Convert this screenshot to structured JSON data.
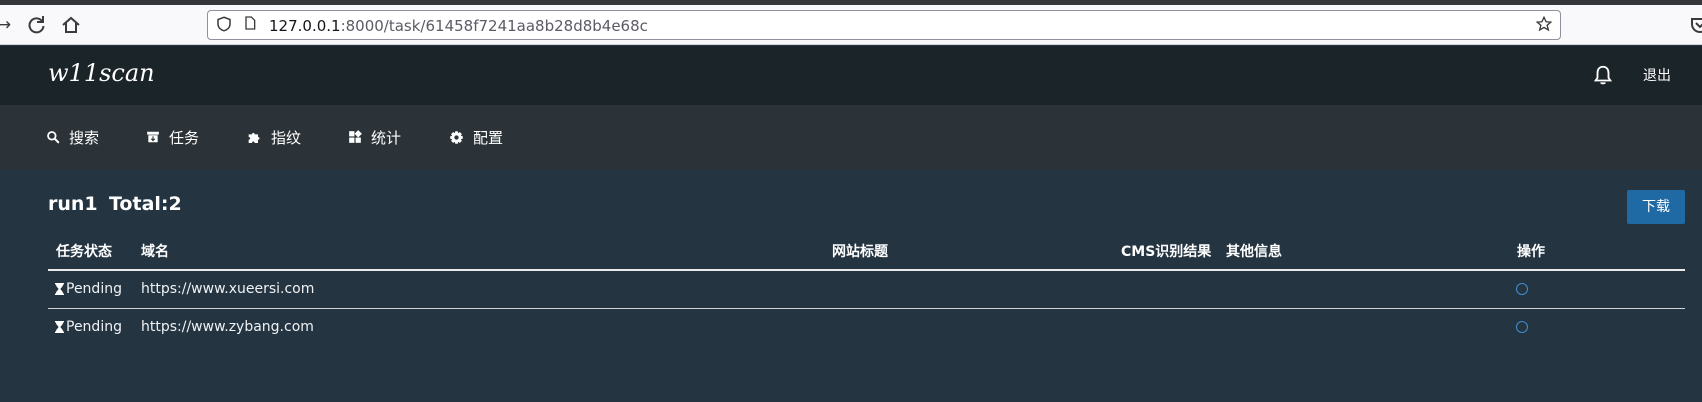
{
  "browser": {
    "url_host": "127.0.0.1",
    "url_rest": ":8000/task/61458f7241aa8b28d8b4e68c"
  },
  "header": {
    "brand": "w11scan",
    "logout_label": "退出"
  },
  "menu": [
    {
      "label": "搜索",
      "icon": "search-icon"
    },
    {
      "label": "任务",
      "icon": "archive-icon"
    },
    {
      "label": "指纹",
      "icon": "puzzle-icon"
    },
    {
      "label": "统计",
      "icon": "grid-icon"
    },
    {
      "label": "配置",
      "icon": "gear-icon"
    }
  ],
  "task": {
    "name": "run1",
    "total_label": "Total:2",
    "download_label": "下载"
  },
  "table": {
    "headers": [
      "任务状态",
      "域名",
      "网站标题",
      "CMS识别结果",
      "其他信息",
      "操作"
    ],
    "rows": [
      {
        "status": "Pending",
        "domain": "https://www.xueersi.com",
        "title": "",
        "cms": "",
        "other": ""
      },
      {
        "status": "Pending",
        "domain": "https://www.zybang.com",
        "title": "",
        "cms": "",
        "other": ""
      }
    ]
  },
  "colors": {
    "header_bg": "#1b2429",
    "menubar_bg": "#2b3338",
    "content_bg": "#243441",
    "button": "#1f6aa5",
    "spinner": "#3f8fd6"
  }
}
